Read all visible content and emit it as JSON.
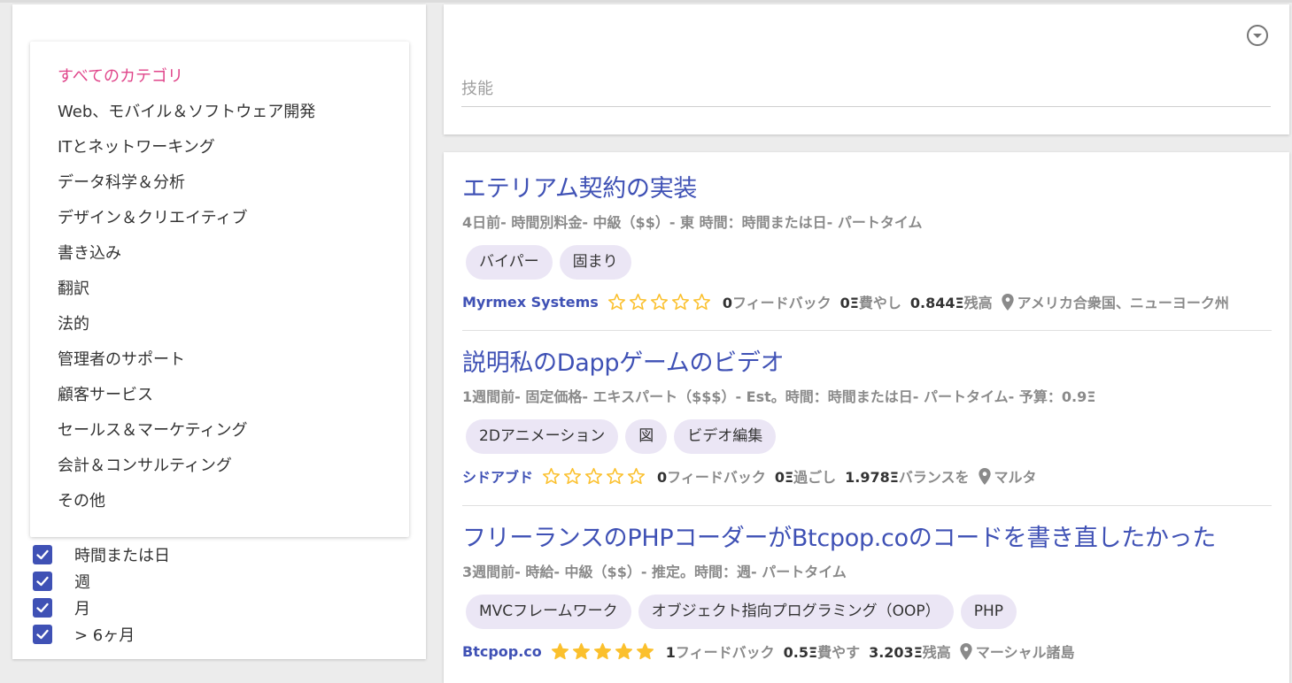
{
  "sidebar": {
    "categories": [
      "すべてのカテゴリ",
      "Web、モバイル＆ソフトウェア開発",
      "ITとネットワーキング",
      "データ科学＆分析",
      "デザイン＆クリエイティブ",
      "書き込み",
      "翻訳",
      "法的",
      "管理者のサポート",
      "顧客サービス",
      "セールス＆マーケティング",
      "会計＆コンサルティング",
      "その他"
    ],
    "active_category": "すべてのカテゴリ",
    "duration_filters": [
      {
        "label": "時間または日",
        "checked": true
      },
      {
        "label": "週",
        "checked": true
      },
      {
        "label": "月",
        "checked": true
      },
      {
        "label": "> 6ヶ月",
        "checked": true
      }
    ]
  },
  "skills": {
    "placeholder": "技能",
    "dropdown_icon": "chevron-down-circle-icon"
  },
  "colors": {
    "accent": "#3f51b5",
    "active_category": "#e0458a",
    "tag_bg": "#ebe6f5",
    "star": "#fbc02d"
  },
  "jobs": [
    {
      "title": "エテリアム契約の実装",
      "meta": "4日前- 時間別料金- 中級（$$）- 東 時間：時間または日- パートタイム",
      "tags": [
        "バイパー",
        "固まり"
      ],
      "company": "Myrmex Systems",
      "rating": 0,
      "feedback_num": "0",
      "feedback_label": "フィードバック",
      "spent_num": "0Ξ",
      "spent_label": "費やし",
      "balance_num": "0.844Ξ",
      "balance_label": "残高",
      "location": "アメリカ合衆国、ニューヨーク州"
    },
    {
      "title": "説明私のDappゲームのビデオ",
      "meta": "1週間前- 固定価格- エキスパート（$$$）- Est。時間：時間または日- パートタイム- 予算：0.9Ξ",
      "tags": [
        "2Dアニメーション",
        "図",
        "ビデオ編集"
      ],
      "company": "シドアブド",
      "rating": 0,
      "feedback_num": "0",
      "feedback_label": "フィードバック",
      "spent_num": "0Ξ",
      "spent_label": "過ごし",
      "balance_num": "1.978Ξ",
      "balance_label": "バランスを",
      "location": "マルタ"
    },
    {
      "title": "フリーランスのPHPコーダーがBtcpop.coのコードを書き直したかった",
      "meta": "3週間前- 時給- 中級（$$）- 推定。時間：週- パートタイム",
      "tags": [
        "MVCフレームワーク",
        "オブジェクト指向プログラミング（OOP）",
        "PHP"
      ],
      "company": "Btcpop.co",
      "rating": 5,
      "feedback_num": "1",
      "feedback_label": "フィードバック",
      "spent_num": "0.5Ξ",
      "spent_label": "費やす",
      "balance_num": "3.203Ξ",
      "balance_label": "残高",
      "location": "マーシャル諸島"
    }
  ]
}
